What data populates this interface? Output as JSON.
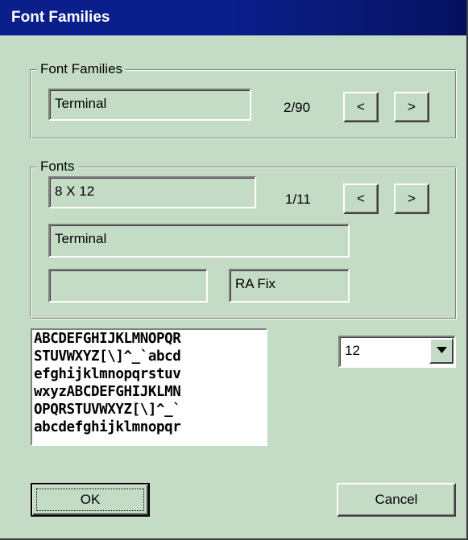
{
  "window": {
    "title": "Font Families"
  },
  "families_group": {
    "legend": "Font Families",
    "value": "Terminal",
    "counter": "2/90",
    "prev_label": "<",
    "next_label": ">"
  },
  "fonts_group": {
    "legend": "Fonts",
    "size_value": "8 X 12",
    "counter": "1/11",
    "prev_label": "<",
    "next_label": ">",
    "face_value": "Terminal",
    "style_value": "",
    "pitch_value": "RA Fix"
  },
  "preview": {
    "lines": [
      "ABCDEFGHIJKLMNOPQR",
      "STUVWXYZ[\\]^_`abcd",
      "efghijklmnopqrstuv",
      "wxyzABCDEFGHIJKLMN",
      "OPQRSTUVWXYZ[\\]^_`",
      "abcdefghijklmnopqr"
    ]
  },
  "size_select": {
    "value": "12",
    "arrow_icon": "chevron-down-icon"
  },
  "buttons": {
    "ok": "OK",
    "cancel": "Cancel"
  }
}
